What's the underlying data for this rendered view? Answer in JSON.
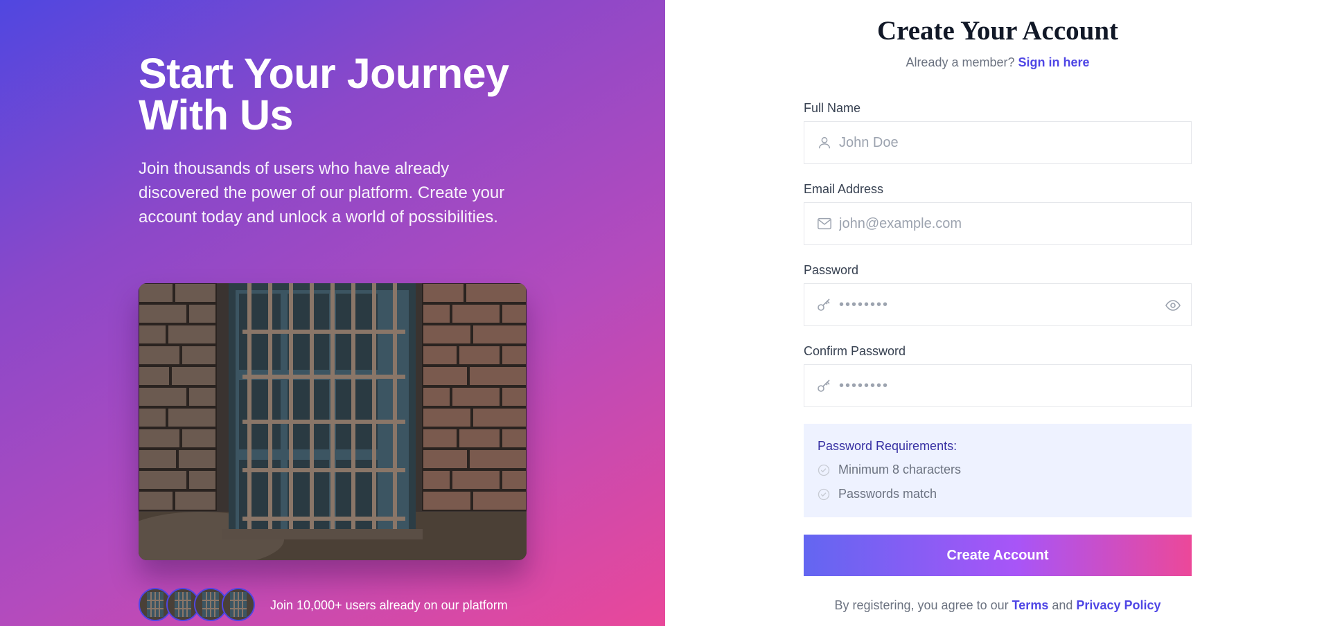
{
  "hero": {
    "title": "Start Your Journey With Us",
    "text": "Join thousands of users who have already discovered the power of our platform. Create your account today and unlock a world of possibilities.",
    "image_icon": "window-photo",
    "avatars_text": "Join 10,000+ users already on our platform"
  },
  "form": {
    "title": "Create Your Account",
    "member_prefix": "Already a member?",
    "signin_link": "Sign in here",
    "full_name": {
      "label": "Full Name",
      "placeholder": "John Doe",
      "icon": "user-icon"
    },
    "email": {
      "label": "Email Address",
      "placeholder": "john@example.com",
      "icon": "mail-icon"
    },
    "password": {
      "label": "Password",
      "value": "••••••••",
      "icon": "key-icon",
      "toggle_icon": "eye-icon"
    },
    "confirm_password": {
      "label": "Confirm Password",
      "value": "••••••••",
      "icon": "key-icon"
    },
    "requirements": {
      "title": "Password Requirements:",
      "items": [
        "Minimum 8 characters",
        "Passwords match"
      ]
    },
    "submit_label": "Create Account",
    "terms_prefix": "By registering, you agree to our",
    "terms_link": "Terms",
    "terms_and": "and",
    "privacy_link": "Privacy Policy"
  },
  "colors": {
    "accent": "#4f46e5",
    "gradient_start": "#5047e0",
    "gradient_end": "#e9489a",
    "requirements_bg": "#eef2ff"
  }
}
